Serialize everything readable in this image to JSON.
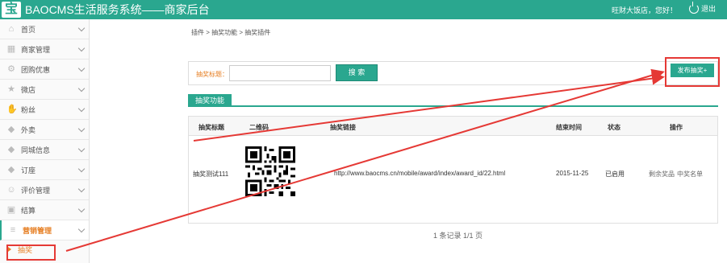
{
  "header": {
    "logo_char": "宝",
    "title": "BAOCMS生活服务系统——商家后台",
    "greeting": "旺财大饭店，您好！",
    "logout_label": "退出"
  },
  "sidebar": {
    "items": [
      {
        "label": "首页",
        "icon": "home-icon"
      },
      {
        "label": "商家管理",
        "icon": "store-icon"
      },
      {
        "label": "团购优惠",
        "icon": "gear-icon"
      },
      {
        "label": "微店",
        "icon": "star-icon"
      },
      {
        "label": "粉丝",
        "icon": "hand-icon"
      },
      {
        "label": "外卖",
        "icon": "tag-icon"
      },
      {
        "label": "同城信息",
        "icon": "tag-icon"
      },
      {
        "label": "订座",
        "icon": "tag-icon"
      },
      {
        "label": "评价管理",
        "icon": "user-icon"
      },
      {
        "label": "结算",
        "icon": "image-icon"
      },
      {
        "label": "营销管理",
        "icon": "layers-icon"
      }
    ],
    "sub_items": [
      {
        "label": "抽奖"
      }
    ]
  },
  "breadcrumb": "插件 > 抽奖功能 > 抽奖插件",
  "search": {
    "label": "抽奖标题：",
    "value": "",
    "placeholder": "",
    "button_label": "搜 索"
  },
  "publish_button_label": "发布抽奖+",
  "tab_label": "抽奖功能",
  "table": {
    "headers": [
      "抽奖标题",
      "二维码",
      "抽奖链接",
      "结束时间",
      "状态",
      "操作"
    ],
    "rows": [
      {
        "title": "抽奖测试111",
        "link": "http://www.baocms.cn/mobile/award/index/award_id/22.html",
        "end_time": "2015-11-25",
        "status": "已启用",
        "action1": "剩余奖品",
        "action2": "中奖名单"
      }
    ]
  },
  "pager": "1 条记录 1/1 页",
  "colors": {
    "brand": "#2aa78f",
    "accent": "#e67e22",
    "annotation": "#e53935"
  }
}
